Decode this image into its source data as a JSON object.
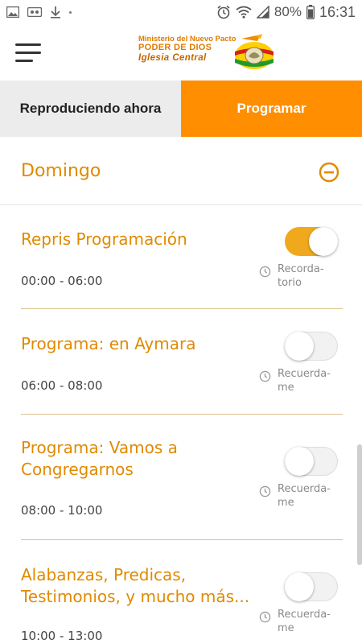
{
  "status_bar": {
    "battery": "80%",
    "time": "16:31",
    "icons": [
      "image-icon",
      "cassette-icon",
      "download-icon",
      "alarm-icon",
      "wifi-icon",
      "signal-icon",
      "battery-icon"
    ]
  },
  "header": {
    "menu_icon": "hamburger-icon",
    "logo": {
      "line1": "Ministerio del Nuevo Pacto",
      "line2": "PODER DE DIOS",
      "line3": "Iglesia Central"
    }
  },
  "tabs": [
    {
      "label": "Reproduciendo ahora",
      "active": false
    },
    {
      "label": "Programar",
      "active": true
    }
  ],
  "day": {
    "title": "Domingo",
    "icon": "collapse-minus-icon"
  },
  "programs": [
    {
      "title": "Repris Programación",
      "time": "00:00 - 06:00",
      "reminder_line1": "Recorda-",
      "reminder_line2": "torio",
      "reminder_on": true
    },
    {
      "title": "Programa: en Aymara",
      "time": "06:00 - 08:00",
      "reminder_line1": "Recuerda-",
      "reminder_line2": "me",
      "reminder_on": false
    },
    {
      "title_line1": "Programa: Vamos a",
      "title_line2": "Congregarnos",
      "time": "08:00 - 10:00",
      "reminder_line1": "Recuerda-",
      "reminder_line2": "me",
      "reminder_on": false
    },
    {
      "title_line1": "Alabanzas, Predicas,",
      "title_line2": "Testimonios, y mucho más...",
      "time": "10:00 - 13:00",
      "reminder_line1": "Recuerda-",
      "reminder_line2": "me",
      "reminder_on": false
    }
  ],
  "colors": {
    "accent": "#ff8f00",
    "title_orange": "#e08a00",
    "toggle_on": "#f0a91c",
    "divider": "#d9c08a"
  }
}
